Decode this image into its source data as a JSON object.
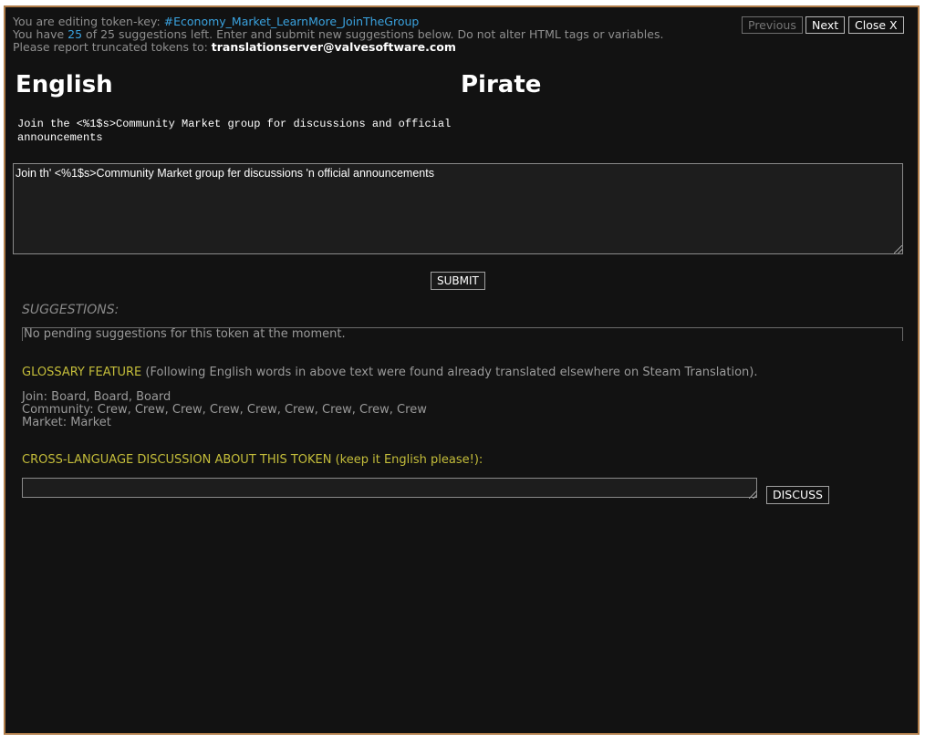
{
  "header": {
    "editing_prefix": "You are editing token-key: ",
    "token_key": "#Economy_Market_LearnMore_JoinTheGroup",
    "have_prefix": "You have ",
    "suggestions_left": "25",
    "have_suffix": " of 25 suggestions left. Enter and submit new suggestions below. Do not alter HTML tags or variables.",
    "report_prefix": "Please report truncated tokens to: ",
    "report_email": "translationserver@valvesoftware.com"
  },
  "nav": {
    "previous_label": "Previous",
    "next_label": "Next",
    "close_label": "Close X"
  },
  "columns": {
    "source_language": "English",
    "target_language": "Pirate"
  },
  "source_text": "Join the <%1$s>Community Market group for discussions and official announcements",
  "translation_value": "Join th' <%1$s>Community Market group fer discussions 'n official announcements",
  "submit_label": "SUBMIT",
  "suggestions": {
    "heading": "SUGGESTIONS:",
    "empty_message": "No pending suggestions for this token at the moment."
  },
  "glossary": {
    "title": "GLOSSARY FEATURE",
    "note": " (Following English words in above text were found already translated elsewhere on Steam Translation).",
    "entries": [
      "Join: Board, Board, Board",
      "Community: Crew, Crew, Crew, Crew, Crew, Crew, Crew, Crew, Crew",
      "Market: Market"
    ]
  },
  "discussion": {
    "heading": "CROSS-LANGUAGE DISCUSSION ABOUT THIS TOKEN (keep it English please!):",
    "input_value": "",
    "button_label": "DISCUSS"
  },
  "colors": {
    "panel_background": "#121212",
    "panel_border": "#b07d4a",
    "link_blue": "#3aa3e0",
    "gold_text": "#c4bd3a"
  }
}
